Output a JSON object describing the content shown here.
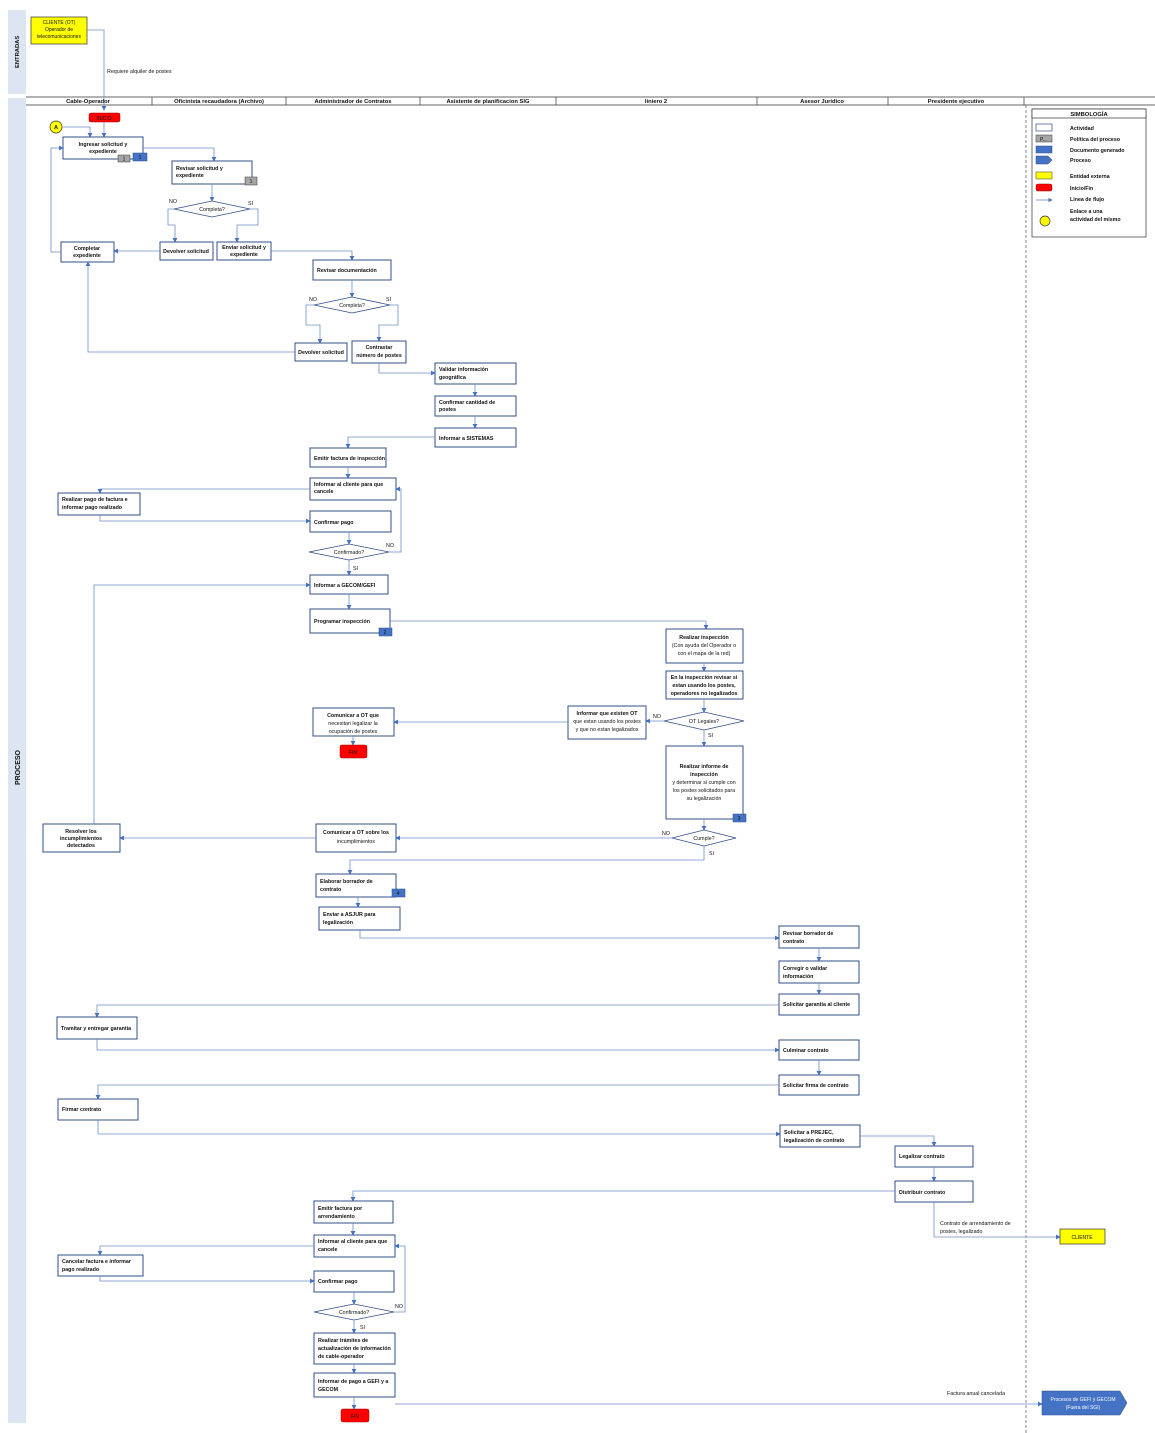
{
  "lanes": {
    "entradas": "ENTRADAS",
    "proceso": "PROCESO",
    "headers": [
      "Cable-Operador",
      "Oficinista recaudadora (Archivo)",
      "Administrador de Contratos",
      "Asistente de planificacion SIG",
      "liniero 2",
      "Asesor Jurídico",
      "Presidente ejecutivo"
    ]
  },
  "client_top": [
    "CLIENTE (OT)",
    "Operador de",
    "telecomunicaciones"
  ],
  "requiere": "Requiere alquiler de postes",
  "start_label": "INICIO",
  "connector_a": "A",
  "fin_label": "FIN",
  "badges": {
    "one": "1",
    "two": "2",
    "three": "3",
    "four": "4"
  },
  "activities": {
    "ingresar": [
      "Ingresar solicitud y",
      "expediente"
    ],
    "revisar_sol": [
      "Revisar solicitud y",
      "expediente"
    ],
    "devolver1": [
      "Devolver solicitud"
    ],
    "enviar_sol": [
      "Enviar solicitud y",
      "expediente"
    ],
    "completar": [
      "Completar",
      "expediente"
    ],
    "revisar_doc": [
      "Revisar documentación"
    ],
    "devolver2": [
      "Devolver solicitud"
    ],
    "contrastar": [
      "Contrastar",
      "número de postes"
    ],
    "validar": [
      "Validar información",
      "geográfica"
    ],
    "confirmar_cant": [
      "Confirmar cantidad de",
      "postes"
    ],
    "informar_sist": [
      "Informar a SISTEMAS"
    ],
    "emitir_insp": [
      "Emitir factura de  inspección"
    ],
    "informar_cli1": [
      "Informar al cliente para que",
      "cancele"
    ],
    "realizar_pago": [
      "Realizar pago de factura e",
      "informar pago realizado"
    ],
    "confirmar_pago1": [
      "Confirmar pago"
    ],
    "informar_gecom": [
      "Informar a GECOM/GEFI"
    ],
    "programar": [
      "Programar inspección"
    ],
    "realizar_insp": [
      "Realizar  inspección",
      "(Con ayuda del Operador o",
      "con el mapa de la red)"
    ],
    "en_insp": [
      "En la inspección revisar si",
      "estan usando los postes,",
      "operadores no legalizados"
    ],
    "informar_ot": [
      "Informar que existen OT",
      "que estan usando los postes",
      "y que no estan legalizados"
    ],
    "comunicar_ot1": [
      "Comunicar a OT que",
      "necesitan legalizar la",
      "ocupación de postes"
    ],
    "informe_insp": [
      "Realizar  informe de",
      "inspección",
      "y determinar  si cumple con",
      "los postes solicitados para",
      "su legalización"
    ],
    "resolver": [
      "Resolver los",
      "incumplimientos",
      "detectados"
    ],
    "comunicar_ot2": [
      "Comunicar a OT sobre los",
      "incumplimientos"
    ],
    "elaborar": [
      "Elaborar borrador de",
      "contrato"
    ],
    "enviar_asjur": [
      "Enviar a ASJUR para",
      "legalización"
    ],
    "revisar_borr": [
      "Revisar borrador de",
      "contrato"
    ],
    "corregir": [
      "Corregir o validar",
      "información"
    ],
    "solicitar_gar": [
      "Solicitar garantía al cliente"
    ],
    "tramitar": [
      "Tramitar y entregar garantía"
    ],
    "culminar": [
      "Culminar contrato"
    ],
    "solicitar_firma": [
      "Solicitar firma de contrato"
    ],
    "firmar": [
      "Firmar contrato"
    ],
    "solicitar_prejec": [
      "Solicitar a PREJEC,",
      "legalización de contrato"
    ],
    "legalizar": [
      "Legalizar contrato"
    ],
    "distribuir": [
      "Distribuir  contrato"
    ],
    "emitir_arr": [
      "Emitir factura por",
      "arrendamiento"
    ],
    "informar_cli2": [
      "Informar al cliente para que",
      "cancele"
    ],
    "cancelar_fac": [
      "Cancelar factura e informar",
      "pago realizado"
    ],
    "confirmar_pago2": [
      "Confirmar pago"
    ],
    "realizar_tram": [
      "Realizar trámites de",
      "actualización de información",
      "de cable-operador"
    ],
    "informar_pago": [
      "Informar de pago a GEFI y a",
      "GECOM"
    ]
  },
  "decisions": {
    "completa1": "Completa?",
    "completa2": "Completa?",
    "confirmado1": "Confirmado?",
    "ot_legales": "OT Legales?",
    "cumple": "Cumple?",
    "confirmado2": "Confirmado?"
  },
  "yes": "SI",
  "no": "NO",
  "contrato_note": [
    "Contrato de arrendamiento  de",
    "postes, legalizado"
  ],
  "cliente_end": "CLIENTE",
  "factura_note": "Factura anual cancelada",
  "procesos": [
    "Procesos de GEFI y GECOM",
    "(Fuera del SGI)"
  ],
  "legend": {
    "title": "SIMBOLOGÍA",
    "items": [
      "Actividad",
      "Política del proceso",
      "Documento generado",
      "Proceso",
      "Entidad externa",
      "Inicio/Fin",
      "Línea de flujo",
      "Enlace a una",
      "actividad del mismo"
    ],
    "p_mark": "P..."
  },
  "colors": {
    "yellow": "#ffff00",
    "red": "#ff0000",
    "blue": "#4472c4",
    "gray": "#a6a6a6",
    "lane_bg": "#dce6f2"
  }
}
